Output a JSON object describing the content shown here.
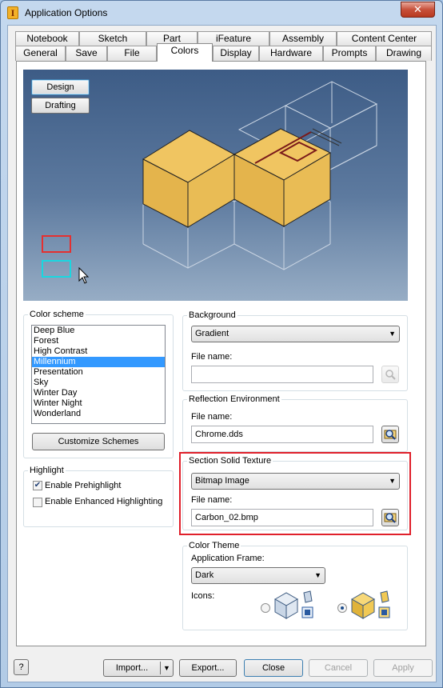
{
  "window": {
    "title": "Application Options",
    "close_glyph": "✕",
    "app_icon_letter": "I"
  },
  "tabs_row1": [
    "Notebook",
    "Sketch",
    "Part",
    "iFeature",
    "Assembly",
    "Content Center"
  ],
  "tabs_row2": [
    "General",
    "Save",
    "File",
    "Colors",
    "Display",
    "Hardware",
    "Prompts",
    "Drawing"
  ],
  "active_tab": "Colors",
  "preview": {
    "design_label": "Design",
    "drafting_label": "Drafting"
  },
  "color_scheme": {
    "label": "Color scheme",
    "items": [
      "Deep Blue",
      "Forest",
      "High Contrast",
      "Millennium",
      "Presentation",
      "Sky",
      "Winter Day",
      "Winter Night",
      "Wonderland"
    ],
    "selected": "Millennium",
    "customize_label": "Customize Schemes"
  },
  "highlight": {
    "label": "Highlight",
    "prehighlight_label": "Enable Prehighlight",
    "prehighlight_checked": true,
    "enhanced_label": "Enable Enhanced Highlighting",
    "enhanced_checked": false
  },
  "background": {
    "label": "Background",
    "value": "Gradient",
    "file_label": "File name:",
    "file_value": ""
  },
  "reflection": {
    "label": "Reflection Environment",
    "file_label": "File name:",
    "file_value": "Chrome.dds"
  },
  "section_texture": {
    "label": "Section Solid Texture",
    "value": "Bitmap Image",
    "file_label": "File name:",
    "file_value": "Carbon_02.bmp"
  },
  "color_theme": {
    "label": "Color Theme",
    "frame_label": "Application Frame:",
    "frame_value": "Dark",
    "icons_label": "Icons:",
    "icons_selected": "color"
  },
  "footer": {
    "import_label": "Import...",
    "export_label": "Export...",
    "close_label": "Close",
    "cancel_label": "Cancel",
    "apply_label": "Apply",
    "help_glyph": "?"
  },
  "colors": {
    "accent_select": "#3399ff",
    "highlight_red": "#e0202b",
    "cube_face": "#e9bd57"
  }
}
